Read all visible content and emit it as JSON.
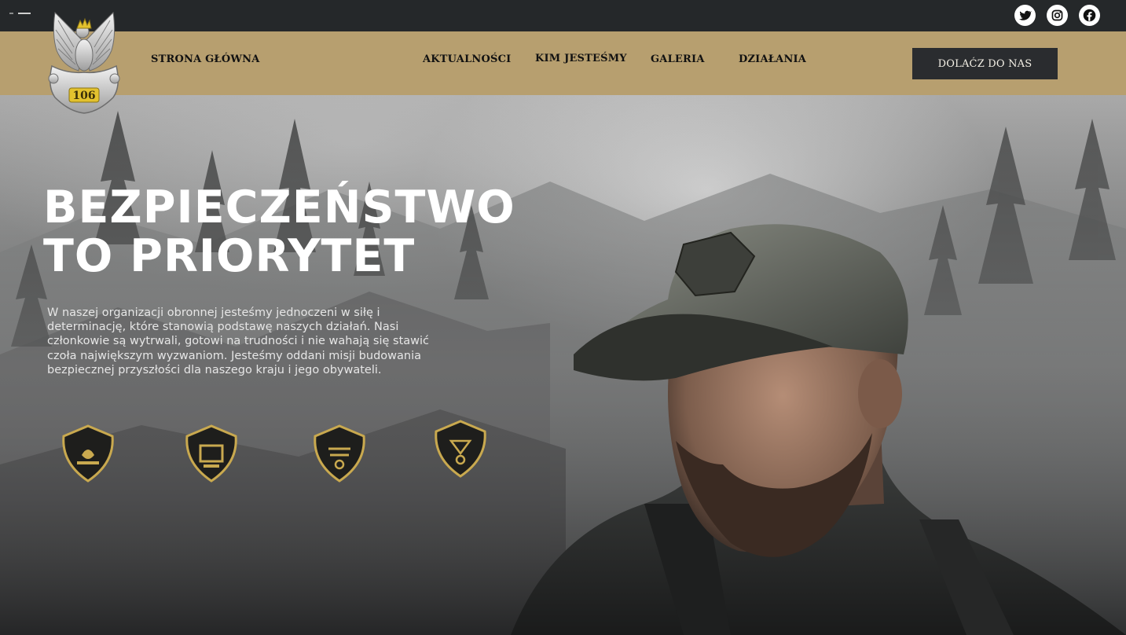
{
  "social": {
    "icons": [
      "twitter-icon",
      "instagram-icon",
      "facebook-icon"
    ]
  },
  "logo": {
    "number": "106",
    "icon": "eagle-emblem-icon"
  },
  "nav": {
    "home": "STRONA GŁÓWNA",
    "news": "AKTUALNOŚCI",
    "about": "KIM JESTEŚMY",
    "gallery": "GALERIA",
    "activities": "DZIAŁANIA",
    "join": "DOLAĆZ DO NAS"
  },
  "hero": {
    "headline_line1": "BEZPIECZEŃSTWO",
    "headline_line2": "TO PRIORYTET",
    "lead": "W naszej organizacji obronnej jesteśmy jednoczeni w siłę i determinację, które stanowią podstawę naszych działań. Nasi członkowie są wytrwali, gotowi na trudności i nie wahają się stawić czoła największym wyzwaniom. Jesteśmy oddani misji budowania bezpiecznej przyszłości dla naszego kraju i jego obywateli."
  },
  "badges": [
    "shield-badge-icon",
    "shield-badge-icon",
    "shield-badge-icon",
    "shield-badge-icon"
  ],
  "colors": {
    "topbar": "#25282a",
    "navbar": "#b79f6f",
    "button": "#2a2c2f",
    "badge_gold": "#c9a94f"
  }
}
